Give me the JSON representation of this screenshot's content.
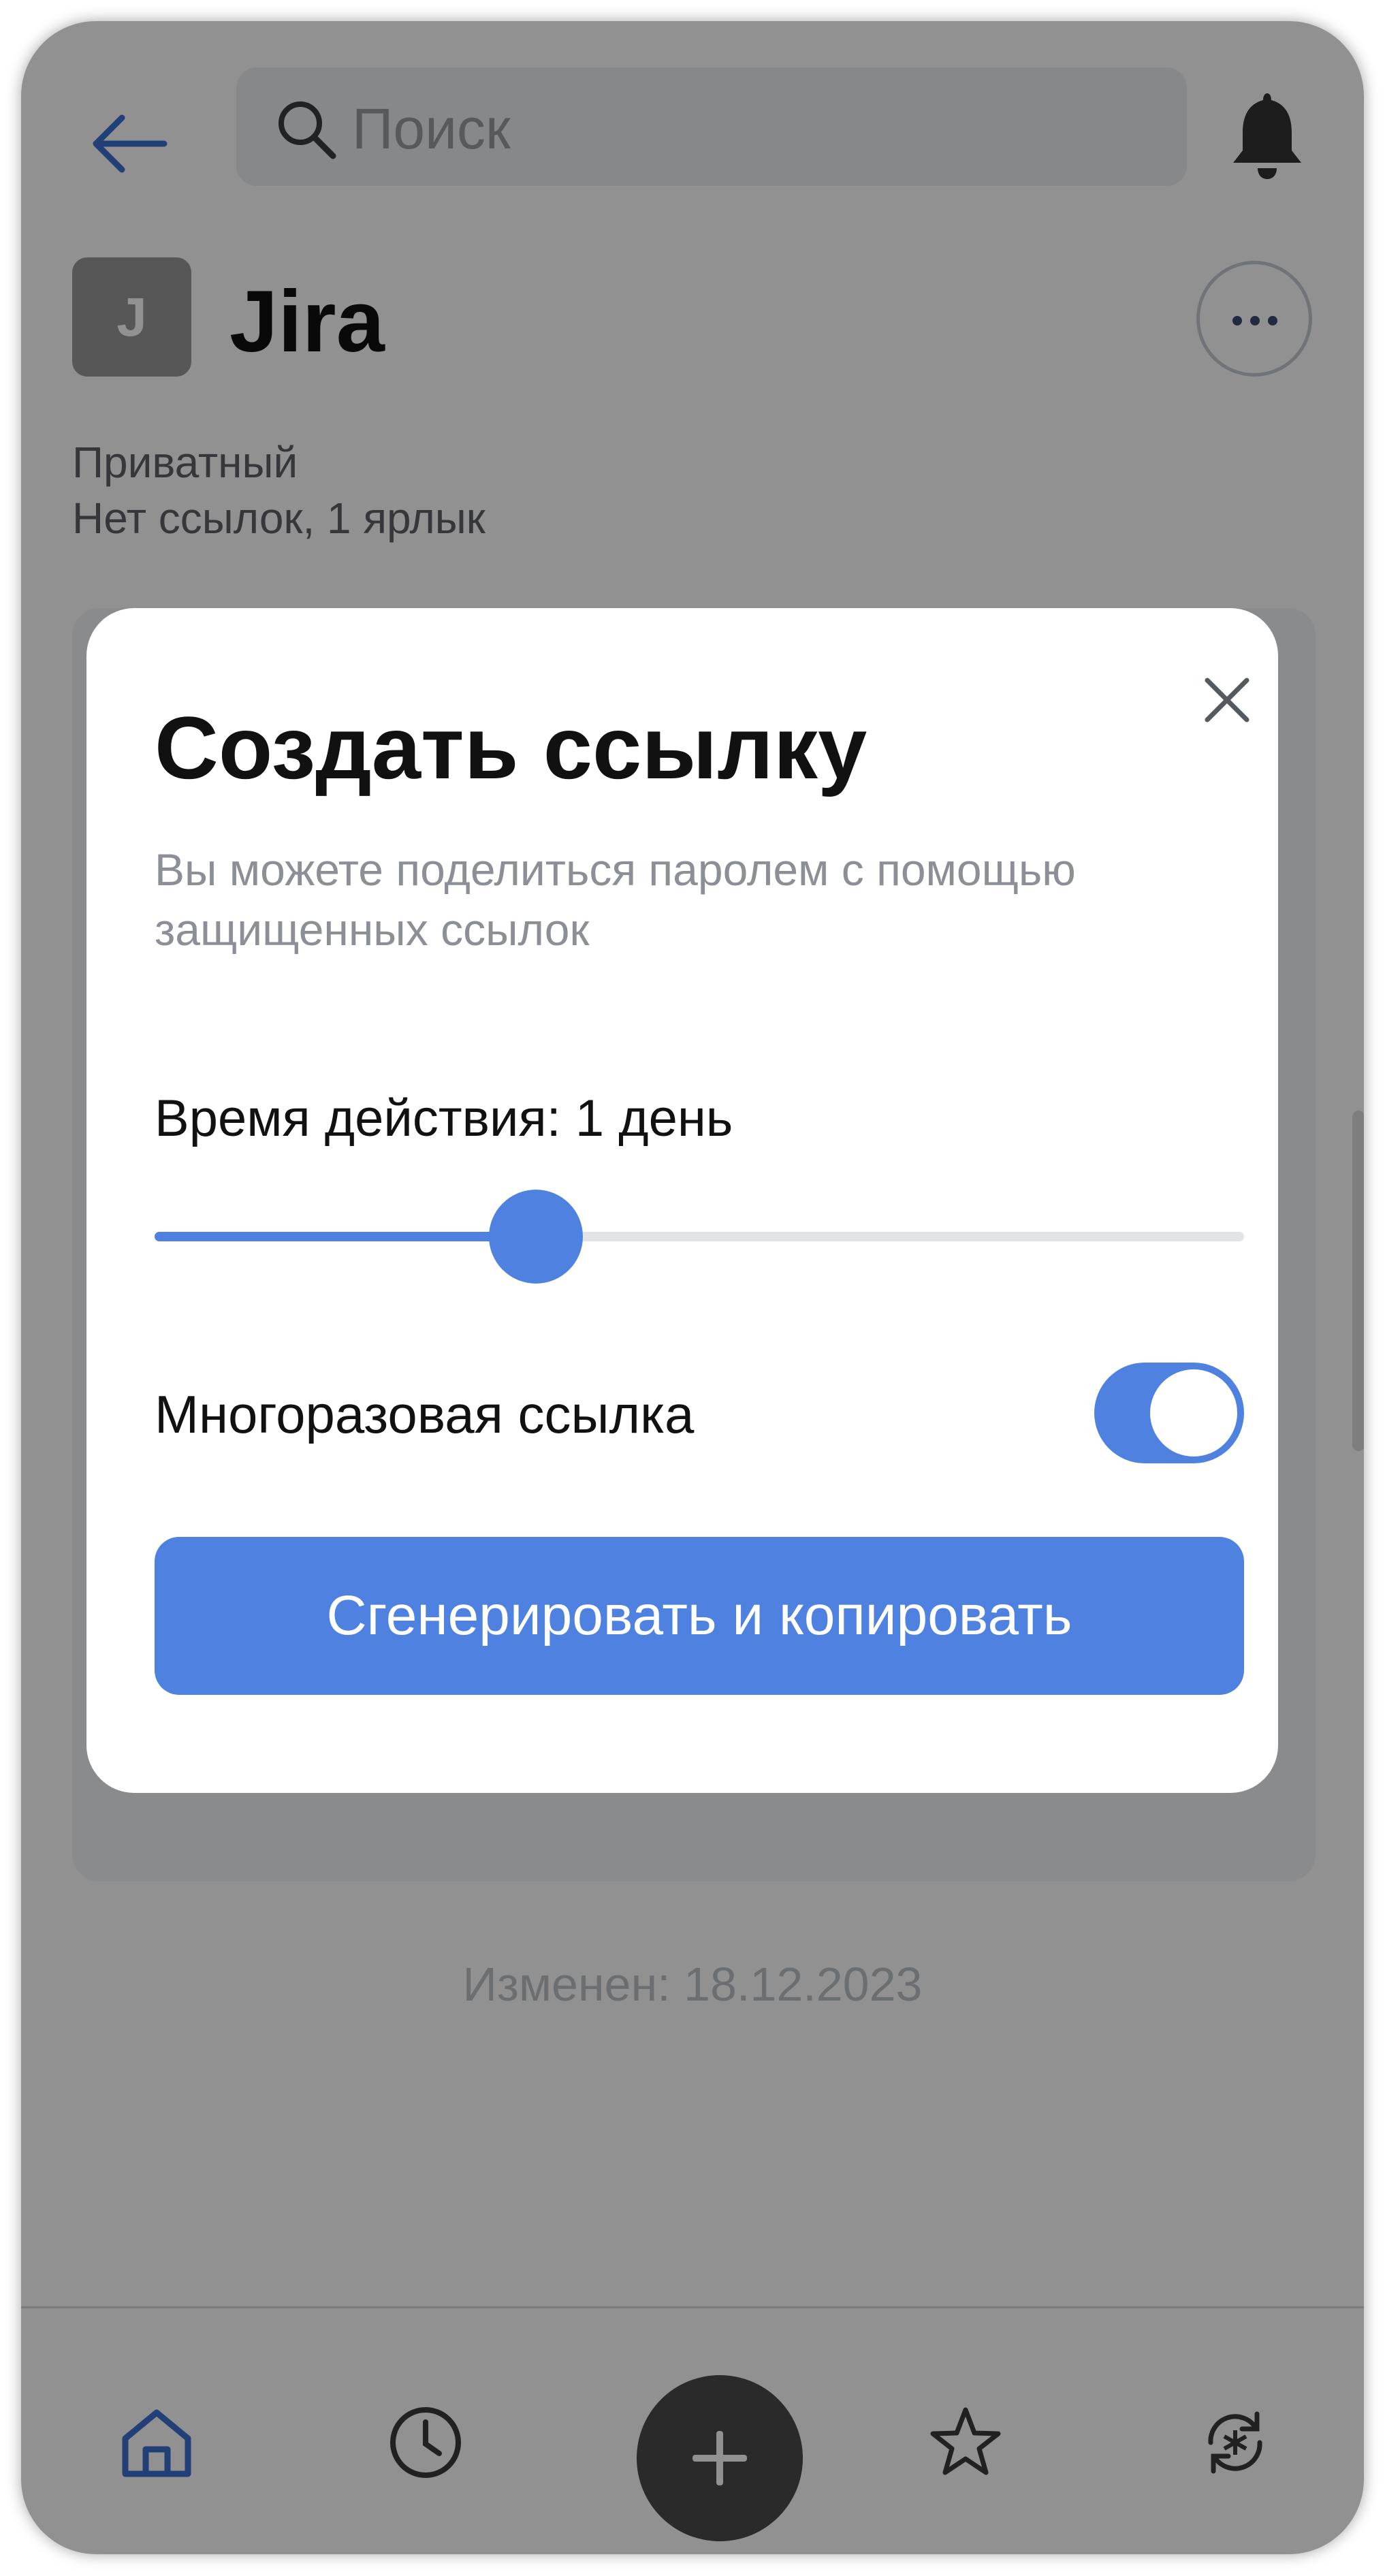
{
  "header": {
    "search_placeholder": "Поиск"
  },
  "item": {
    "icon_letter": "J",
    "title": "Jira",
    "visibility": "Приватный",
    "summary": "Нет ссылок, 1 ярлык",
    "modified": "Изменен: 18.12.2023"
  },
  "modal": {
    "title": "Создать ссылку",
    "description": "Вы можете поделиться паролем с помощью защищенных ссылок",
    "duration_label": "Время действия: 1 день",
    "duration_slider_fraction": 0.35,
    "reusable_label": "Многоразовая ссылка",
    "reusable_enabled": true,
    "generate_button": "Сгенерировать и копировать"
  },
  "tabs": [
    "home-icon",
    "clock-icon",
    "plus-icon",
    "star-icon",
    "sync-icon"
  ],
  "colors": {
    "accent": "#4f82e0",
    "dim_overlay": "rgba(0,0,0,0.43)"
  }
}
